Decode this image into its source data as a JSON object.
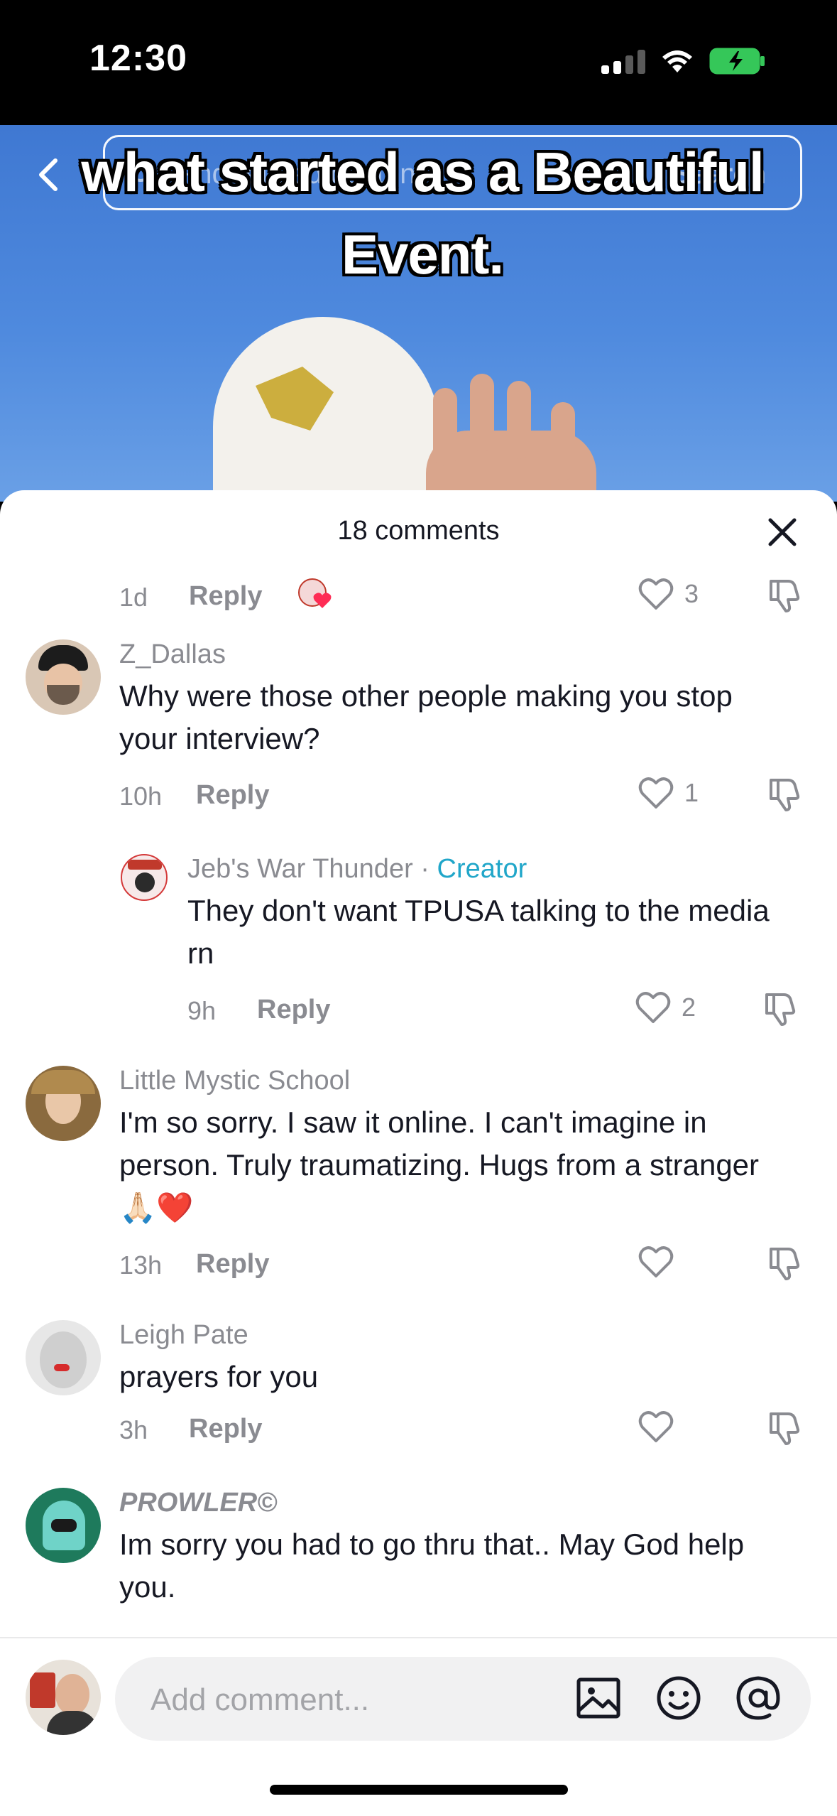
{
  "status_bar": {
    "time": "12:30"
  },
  "video": {
    "caption_line1": "what started as a Beautiful",
    "caption_line2": "Event.",
    "search_placeholder": "Find related content",
    "search_action": "Search"
  },
  "sheet": {
    "title": "18 comments"
  },
  "comments": [
    {
      "time": "1d",
      "reply": "Reply",
      "likes": "3"
    },
    {
      "username": "Z_Dallas",
      "text": "Why were those other people making you stop your interview?",
      "time": "10h",
      "reply": "Reply",
      "likes": "1"
    },
    {
      "username": "Jeb's War Thunder",
      "separator": "·",
      "badge": "Creator",
      "text": "They don't want TPUSA talking to the media rn",
      "time": "9h",
      "reply": "Reply",
      "likes": "2"
    },
    {
      "username": "Little Mystic School",
      "text": "I'm so sorry. I saw it online. I can't imagine in person. Truly traumatizing. Hugs from a stranger 🙏🏻❤️",
      "time": "13h",
      "reply": "Reply",
      "likes": ""
    },
    {
      "username": "Leigh Pate",
      "text": "prayers for you",
      "time": "3h",
      "reply": "Reply",
      "likes": ""
    },
    {
      "username": "PROWLER©",
      "text": "Im sorry you had to go thru that.. May God help you."
    }
  ],
  "input": {
    "placeholder": "Add comment..."
  },
  "colors": {
    "creator": "#20a6c9",
    "like_heart": "#fe2c55",
    "muted": "#8a8b91",
    "text": "#161823"
  },
  "icons": [
    "back-arrow-icon",
    "search-icon",
    "close-icon",
    "heart-icon",
    "dislike-icon",
    "image-icon",
    "emoji-icon",
    "mention-icon"
  ]
}
